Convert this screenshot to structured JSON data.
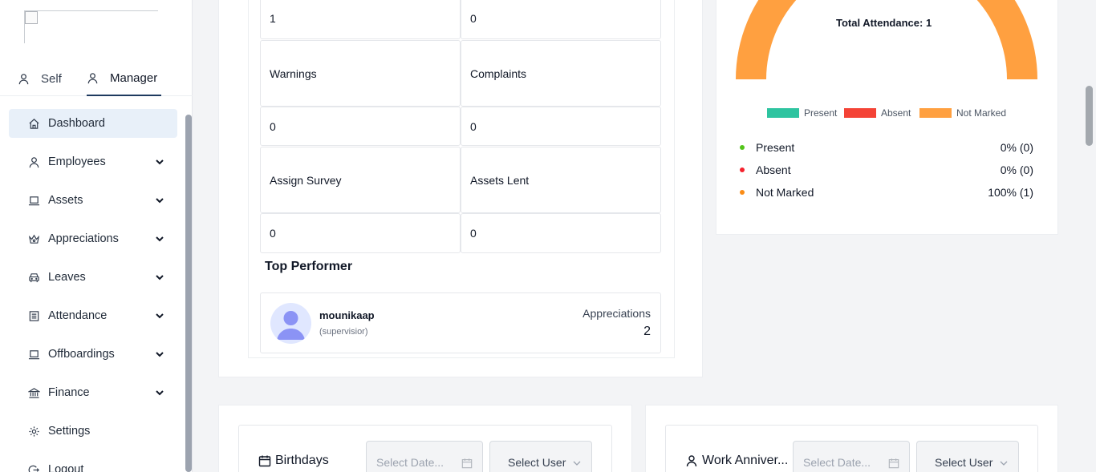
{
  "sidebar": {
    "tabs": {
      "self": "Self",
      "manager": "Manager"
    },
    "items": [
      {
        "label": "Dashboard",
        "icon": "home-icon",
        "active": true
      },
      {
        "label": "Employees",
        "icon": "user-icon",
        "expandable": true
      },
      {
        "label": "Assets",
        "icon": "laptop-icon",
        "expandable": true
      },
      {
        "label": "Appreciations",
        "icon": "crown-icon",
        "expandable": true
      },
      {
        "label": "Leaves",
        "icon": "car-icon",
        "expandable": true
      },
      {
        "label": "Attendance",
        "icon": "list-icon",
        "expandable": true
      },
      {
        "label": "Offboardings",
        "icon": "laptop-icon",
        "expandable": true
      },
      {
        "label": "Finance",
        "icon": "bank-icon",
        "expandable": true
      },
      {
        "label": "Settings",
        "icon": "gear-icon"
      },
      {
        "label": "Logout",
        "icon": "logout-icon"
      }
    ]
  },
  "stats": {
    "row1": {
      "left_value": "1",
      "right_value": "0"
    },
    "row2": {
      "left_label": "Warnings",
      "right_label": "Complaints",
      "left_value": "0",
      "right_value": "0"
    },
    "row3": {
      "left_label": "Assign Survey",
      "right_label": "Assets Lent",
      "left_value": "0",
      "right_value": "0"
    }
  },
  "top_performer": {
    "title": "Top Performer",
    "name": "mounikaap",
    "role": "(supervisior)",
    "appreciations_label": "Appreciations",
    "appreciations_count": "2"
  },
  "attendance": {
    "total_label": "Total Attendance: 1",
    "legend": [
      {
        "label": "Present",
        "color": "#2ec4a0"
      },
      {
        "label": "Absent",
        "color": "#f44336"
      },
      {
        "label": "Not Marked",
        "color": "#ffa040"
      }
    ],
    "stats": [
      {
        "label": "Present",
        "value": "0% (0)",
        "color": "#52c41a"
      },
      {
        "label": "Absent",
        "value": "0% (0)",
        "color": "#f5222d"
      },
      {
        "label": "Not Marked",
        "value": "100% (1)",
        "color": "#fa8c16"
      }
    ],
    "chart_data": {
      "type": "pie",
      "categories": [
        "Present",
        "Absent",
        "Not Marked"
      ],
      "values": [
        0,
        0,
        1
      ]
    }
  },
  "birthdays": {
    "title": "Birthdays",
    "date_placeholder": "Select Date...",
    "select_user": "Select User"
  },
  "anniversaries": {
    "title": "Work Anniver...",
    "date_placeholder": "Select Date...",
    "select_user": "Select User"
  }
}
